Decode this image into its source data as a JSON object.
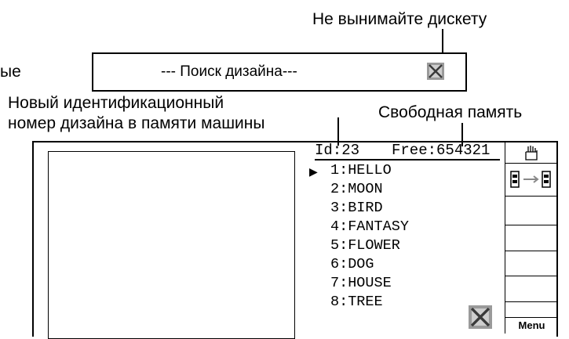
{
  "annotations": {
    "dont_remove_disk": "Не вынимайте дискету",
    "cut_left": "ые",
    "new_id_line1": "Новый идентификационный",
    "new_id_line2": "номер дизайна в памяти машины",
    "free_memory": "Свободная память"
  },
  "banner": {
    "text": "--- Поиск дизайна---",
    "icon": "disk-busy-icon"
  },
  "screen": {
    "id_label": "Id:23",
    "free_label": "Free:654321",
    "selected_index": 0,
    "designs": [
      "1:HELLO",
      "2:MOON",
      "3:BIRD",
      "4:FANTASY",
      "5:FLOWER",
      "6:DOG",
      "7:HOUSE",
      "8:TREE"
    ],
    "side_buttons": [
      "hand-icon",
      "card-transfer-icon",
      "",
      "",
      "",
      "",
      ""
    ],
    "menu_label": "Menu"
  }
}
